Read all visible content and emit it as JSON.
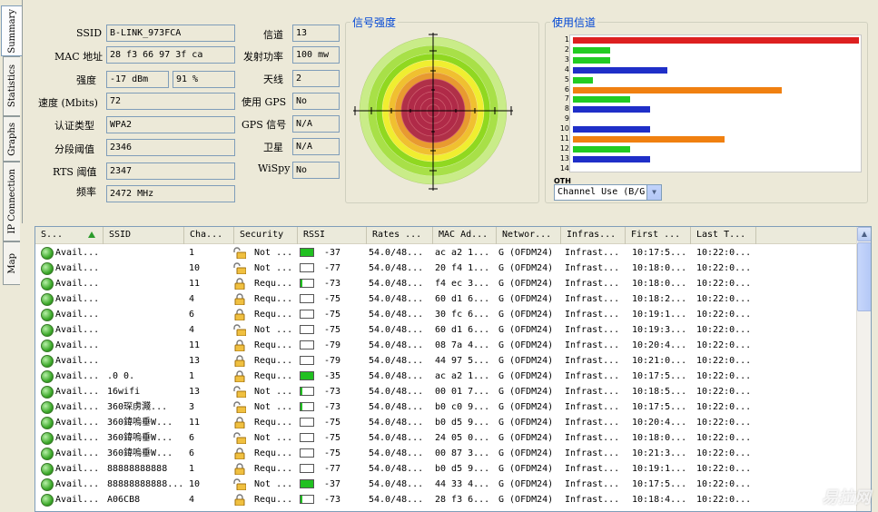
{
  "tabs": [
    {
      "label": "Summary"
    },
    {
      "label": "Statistics"
    },
    {
      "label": "Graphs"
    },
    {
      "label": "IP Connection"
    },
    {
      "label": "Map"
    }
  ],
  "info": {
    "ssid_label": "SSID",
    "ssid": "B-LINK_973FCA",
    "mac_label": "MAC 地址",
    "mac": "28 f3 66 97 3f ca",
    "strength_label": "强度",
    "strength_dbm": "-17 dBm",
    "strength_pct": "91 %",
    "speed_label": "速度 (Mbits)",
    "speed": "72",
    "auth_label": "认证类型",
    "auth": "WPA2",
    "frag_label": "分段阈值",
    "frag": "2346",
    "rts_label": "RTS 阈值",
    "rts": "2347",
    "freq_label": "频率",
    "freq": "2472 MHz",
    "channel_label": "信道",
    "channel": "13",
    "power_label": "发射功率",
    "power": "100 mw",
    "antenna_label": "天线",
    "antenna": "2",
    "gps_label": "使用 GPS",
    "gps": "No",
    "gps_signal_label": "GPS 信号",
    "gps_signal": "N/A",
    "satellite_label": "卫星",
    "satellite": "N/A",
    "wispy_label": "WiSpy",
    "wispy": "No"
  },
  "signal_title": "信号强度",
  "channel_title": "使用信道",
  "channel_select": "Channel Use (B/G",
  "oth_label": "OTH",
  "chart_data": {
    "type": "bar",
    "categories": [
      "1",
      "2",
      "3",
      "4",
      "5",
      "6",
      "7",
      "8",
      "9",
      "10",
      "11",
      "12",
      "13",
      "14"
    ],
    "values": [
      100,
      13,
      13,
      33,
      7,
      73,
      20,
      27,
      0,
      27,
      53,
      20,
      27,
      0
    ],
    "colors": [
      "#dd2020",
      "#22cc22",
      "#22cc22",
      "#1f2fc8",
      "#22cc22",
      "#f08010",
      "#22cc22",
      "#1f2fc8",
      "#ffffff",
      "#1f2fc8",
      "#f08010",
      "#22cc22",
      "#1f2fc8",
      "#ffffff"
    ],
    "ylim": [
      0,
      100
    ]
  },
  "table": {
    "headers": [
      "S...",
      "SSID",
      "Cha...",
      "Security",
      "RSSI",
      "Rates ...",
      "MAC Ad...",
      "Networ...",
      "Infras...",
      "First ...",
      "Last T..."
    ],
    "rows": [
      {
        "status": "Avail...",
        "ssid": "",
        "ch": "1",
        "sec": "Not ...",
        "rssi": "-37",
        "fill": 1.0,
        "rates": "54.0/48...",
        "mac": "ac a2 1...",
        "net": "G (OFDM24)",
        "infra": "Infrast...",
        "first": "10:17:5...",
        "last": "10:22:0...",
        "locked": false
      },
      {
        "status": "Avail...",
        "ssid": "",
        "ch": "10",
        "sec": "Not ...",
        "rssi": "-77",
        "fill": 0.0,
        "rates": "54.0/48...",
        "mac": "20 f4 1...",
        "net": "G (OFDM24)",
        "infra": "Infrast...",
        "first": "10:18:0...",
        "last": "10:22:0...",
        "locked": false
      },
      {
        "status": "Avail...",
        "ssid": "",
        "ch": "11",
        "sec": "Requ...",
        "rssi": "-73",
        "fill": 0.15,
        "rates": "54.0/48...",
        "mac": "f4 ec 3...",
        "net": "G (OFDM24)",
        "infra": "Infrast...",
        "first": "10:18:0...",
        "last": "10:22:0...",
        "locked": true
      },
      {
        "status": "Avail...",
        "ssid": "",
        "ch": "4",
        "sec": "Requ...",
        "rssi": "-75",
        "fill": 0.0,
        "rates": "54.0/48...",
        "mac": "60 d1 6...",
        "net": "G (OFDM24)",
        "infra": "Infrast...",
        "first": "10:18:2...",
        "last": "10:22:0...",
        "locked": true
      },
      {
        "status": "Avail...",
        "ssid": "",
        "ch": "6",
        "sec": "Requ...",
        "rssi": "-75",
        "fill": 0.0,
        "rates": "54.0/48...",
        "mac": "30 fc 6...",
        "net": "G (OFDM24)",
        "infra": "Infrast...",
        "first": "10:19:1...",
        "last": "10:22:0...",
        "locked": true
      },
      {
        "status": "Avail...",
        "ssid": "",
        "ch": "4",
        "sec": "Not ...",
        "rssi": "-75",
        "fill": 0.0,
        "rates": "54.0/48...",
        "mac": "60 d1 6...",
        "net": "G (OFDM24)",
        "infra": "Infrast...",
        "first": "10:19:3...",
        "last": "10:22:0...",
        "locked": false
      },
      {
        "status": "Avail...",
        "ssid": "",
        "ch": "11",
        "sec": "Requ...",
        "rssi": "-79",
        "fill": 0.0,
        "rates": "54.0/48...",
        "mac": "08 7a 4...",
        "net": "G (OFDM24)",
        "infra": "Infrast...",
        "first": "10:20:4...",
        "last": "10:22:0...",
        "locked": true
      },
      {
        "status": "Avail...",
        "ssid": "",
        "ch": "13",
        "sec": "Requ...",
        "rssi": "-79",
        "fill": 0.0,
        "rates": "54.0/48...",
        "mac": "44 97 5...",
        "net": "G (OFDM24)",
        "infra": "Infrast...",
        "first": "10:21:0...",
        "last": "10:22:0...",
        "locked": true
      },
      {
        "status": "Avail...",
        "ssid": ".0 0.",
        "ch": "1",
        "sec": "Requ...",
        "rssi": "-35",
        "fill": 1.0,
        "rates": "54.0/48...",
        "mac": "ac a2 1...",
        "net": "G (OFDM24)",
        "infra": "Infrast...",
        "first": "10:17:5...",
        "last": "10:22:0...",
        "locked": true
      },
      {
        "status": "Avail...",
        "ssid": "16wifi",
        "ch": "13",
        "sec": "Not ...",
        "rssi": "-73",
        "fill": 0.15,
        "rates": "54.0/48...",
        "mac": "00 01 7...",
        "net": "G (OFDM24)",
        "infra": "Infrast...",
        "first": "10:18:5...",
        "last": "10:22:0...",
        "locked": false
      },
      {
        "status": "Avail...",
        "ssid": "360琛虏濺...",
        "ch": "3",
        "sec": "Not ...",
        "rssi": "-73",
        "fill": 0.15,
        "rates": "54.0/48...",
        "mac": "b0 c0 9...",
        "net": "G (OFDM24)",
        "infra": "Infrast...",
        "first": "10:17:5...",
        "last": "10:22:0...",
        "locked": false
      },
      {
        "status": "Avail...",
        "ssid": "360鍏嗚垂W...",
        "ch": "11",
        "sec": "Requ...",
        "rssi": "-75",
        "fill": 0.0,
        "rates": "54.0/48...",
        "mac": "b0 d5 9...",
        "net": "G (OFDM24)",
        "infra": "Infrast...",
        "first": "10:20:4...",
        "last": "10:22:0...",
        "locked": true
      },
      {
        "status": "Avail...",
        "ssid": "360鍏嗚垂W...",
        "ch": "6",
        "sec": "Not ...",
        "rssi": "-75",
        "fill": 0.0,
        "rates": "54.0/48...",
        "mac": "24 05 0...",
        "net": "G (OFDM24)",
        "infra": "Infrast...",
        "first": "10:18:0...",
        "last": "10:22:0...",
        "locked": false
      },
      {
        "status": "Avail...",
        "ssid": "360鍏嗚垂W...",
        "ch": "6",
        "sec": "Requ...",
        "rssi": "-75",
        "fill": 0.0,
        "rates": "54.0/48...",
        "mac": "00 87 3...",
        "net": "G (OFDM24)",
        "infra": "Infrast...",
        "first": "10:21:3...",
        "last": "10:22:0...",
        "locked": true
      },
      {
        "status": "Avail...",
        "ssid": "88888888888",
        "ch": "1",
        "sec": "Requ...",
        "rssi": "-77",
        "fill": 0.0,
        "rates": "54.0/48...",
        "mac": "b0 d5 9...",
        "net": "G (OFDM24)",
        "infra": "Infrast...",
        "first": "10:19:1...",
        "last": "10:22:0...",
        "locked": true
      },
      {
        "status": "Avail...",
        "ssid": "88888888888...",
        "ch": "10",
        "sec": "Not ...",
        "rssi": "-37",
        "fill": 1.0,
        "rates": "54.0/48...",
        "mac": "44 33 4...",
        "net": "G (OFDM24)",
        "infra": "Infrast...",
        "first": "10:17:5...",
        "last": "10:22:0...",
        "locked": false
      },
      {
        "status": "Avail...",
        "ssid": "A06CB8",
        "ch": "4",
        "sec": "Requ...",
        "rssi": "-73",
        "fill": 0.15,
        "rates": "54.0/48...",
        "mac": "28 f3 6...",
        "net": "G (OFDM24)",
        "infra": "Infrast...",
        "first": "10:18:4...",
        "last": "10:22:0...",
        "locked": true
      }
    ]
  },
  "watermark": "易拉网"
}
